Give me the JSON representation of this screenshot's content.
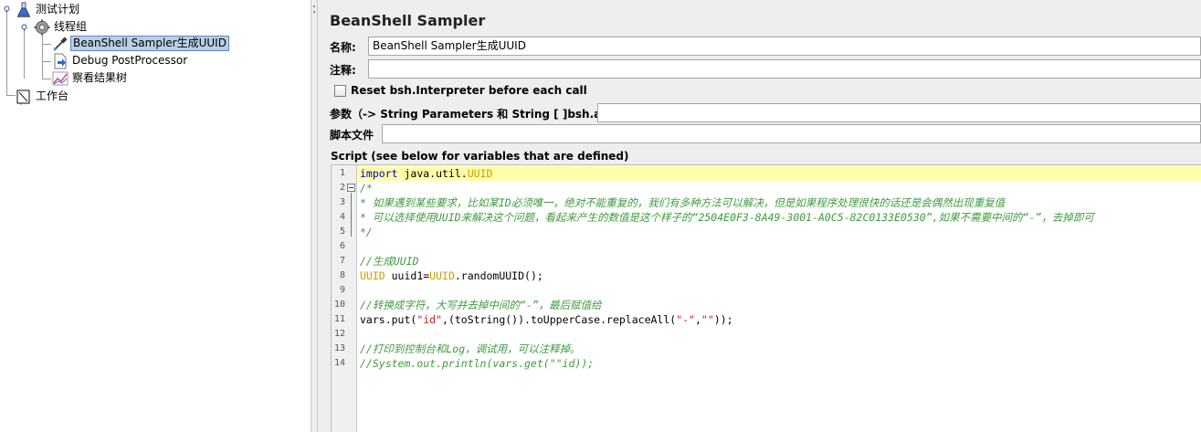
{
  "tree": {
    "items": [
      {
        "label": "测试计划",
        "icon": "test-plan-flask-icon"
      },
      {
        "label": "线程组",
        "icon": "gear-icon"
      },
      {
        "label": "BeanShell Sampler生成UUID",
        "icon": "pipette-icon",
        "selected": true
      },
      {
        "label": "Debug PostProcessor",
        "icon": "document-arrow-icon"
      },
      {
        "label": "察看结果树",
        "icon": "results-tree-graph-icon"
      },
      {
        "label": "工作台",
        "icon": "workbench-icon"
      }
    ]
  },
  "sampler": {
    "title": "BeanShell Sampler",
    "name_label": "名称:",
    "name_value": "BeanShell Sampler生成UUID",
    "comment_label": "注释:",
    "comment_value": "",
    "reset_label": "Reset bsh.Interpreter before each call",
    "reset_checked": false,
    "params_label": "参数（-> String Parameters 和 String [ ]bsh.args）",
    "params_value": "",
    "script_file_label": "脚本文件",
    "script_file_value": "",
    "script_caption": "Script (see below for variables that are defined)"
  },
  "editor": {
    "current_line": 1,
    "lines": [
      {
        "n": "1",
        "tokens": [
          {
            "t": "import",
            "c": "kw"
          },
          {
            "t": " java.util.",
            "c": ""
          },
          {
            "t": "UUID",
            "c": "ty"
          }
        ]
      },
      {
        "n": "2",
        "tokens": [
          {
            "t": "/*",
            "c": "cm"
          }
        ],
        "fold": true
      },
      {
        "n": "3",
        "tokens": [
          {
            "t": "* 如果遇到某些要求，比如某ID必须唯一，绝对不能重复的，我们有多种方法可以解决，但是如果程序处理很快的话还是会偶然出现重复值",
            "c": "cm"
          }
        ]
      },
      {
        "n": "4",
        "tokens": [
          {
            "t": "* 可以选择使用UUID来解决这个问题，看起来产生的数值是这个样子的“2504E0F3-8A49-3001-A0C5-82C0133E0530”,如果不需要中间的“-”，去掉即可",
            "c": "cm"
          }
        ]
      },
      {
        "n": "5",
        "tokens": [
          {
            "t": "*/",
            "c": "cm"
          }
        ]
      },
      {
        "n": "6",
        "tokens": []
      },
      {
        "n": "7",
        "tokens": [
          {
            "t": "//生成UUID",
            "c": "cm"
          }
        ]
      },
      {
        "n": "8",
        "tokens": [
          {
            "t": "UUID",
            "c": "ty"
          },
          {
            "t": " uuid1=",
            "c": ""
          },
          {
            "t": "UUID",
            "c": "ty"
          },
          {
            "t": ".randomUUID();",
            "c": ""
          }
        ]
      },
      {
        "n": "9",
        "tokens": []
      },
      {
        "n": "10",
        "tokens": [
          {
            "t": "//转换成字符，大写并去掉中间的“-”，最后赋值给",
            "c": "cm"
          }
        ]
      },
      {
        "n": "11",
        "tokens": [
          {
            "t": "vars.put(",
            "c": ""
          },
          {
            "t": "\"id\"",
            "c": "st"
          },
          {
            "t": ",(toString()).toUpperCase.replaceAll(",
            "c": ""
          },
          {
            "t": "\"-\"",
            "c": "st"
          },
          {
            "t": ",",
            "c": ""
          },
          {
            "t": "\"\"",
            "c": "st"
          },
          {
            "t": "));",
            "c": ""
          }
        ]
      },
      {
        "n": "12",
        "tokens": []
      },
      {
        "n": "13",
        "tokens": [
          {
            "t": "//打印到控制台和Log，调试用，可以注释掉。",
            "c": "cm"
          }
        ]
      },
      {
        "n": "14",
        "tokens": [
          {
            "t": "//System.out.println(vars.get(\"\"id));",
            "c": "cm"
          }
        ]
      }
    ]
  },
  "colors": {
    "selection_bg": "#b8cfe5",
    "current_line_bg": "#ffffaa",
    "keyword": "#0000cc",
    "type": "#c8a000",
    "comment": "#3f9b3f",
    "string": "#c81e1e"
  }
}
